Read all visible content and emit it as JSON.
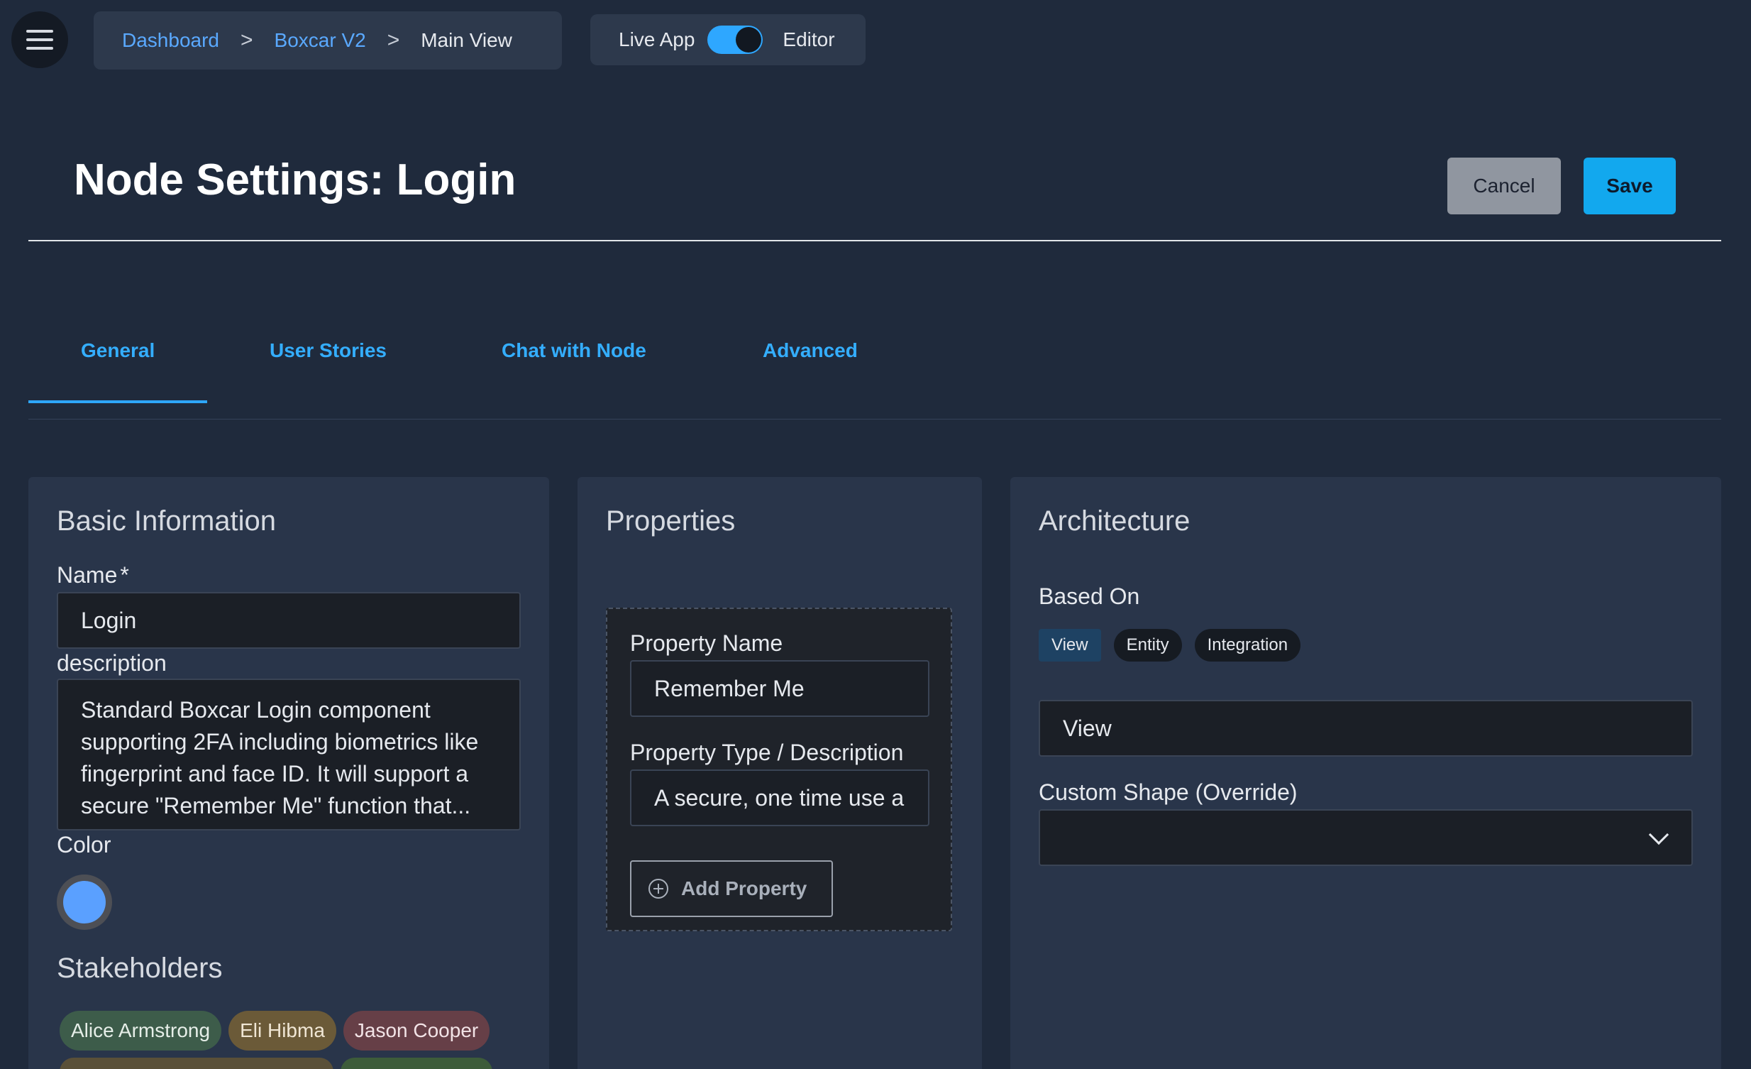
{
  "topbar": {
    "menu_icon": "hamburger-menu-icon",
    "breadcrumb": {
      "items": [
        "Dashboard",
        "Boxcar V2"
      ],
      "separator": ">",
      "current": "Main View"
    },
    "mode": {
      "left_label": "Live App",
      "right_label": "Editor",
      "state": "Editor"
    }
  },
  "header": {
    "title": "Node Settings: Login",
    "cancel_label": "Cancel",
    "save_label": "Save"
  },
  "tabs": {
    "items": [
      {
        "label": "General",
        "active": true
      },
      {
        "label": "User Stories",
        "active": false
      },
      {
        "label": "Chat with Node",
        "active": false
      },
      {
        "label": "Advanced",
        "active": false
      }
    ],
    "accent": "#2ea7ff"
  },
  "basic": {
    "heading": "Basic Information",
    "name_label": "Name",
    "required_marker": "*",
    "name_value": "Login",
    "description_label": "description",
    "description_value": "Standard Boxcar Login component supporting 2FA including biometrics like fingerprint and face ID. It will support a secure \"Remember Me\" function that...",
    "color_label": "Color",
    "color_value": "#5aa0ff",
    "stakeholders_heading": "Stakeholders",
    "stakeholders": [
      {
        "name": "Alice Armstrong",
        "color": "#3d5c4a"
      },
      {
        "name": "Eli Hibma",
        "color": "#6b5a38"
      },
      {
        "name": "Jason Cooper",
        "color": "#663f47"
      }
    ]
  },
  "properties": {
    "heading": "Properties",
    "property_name_label": "Property Name",
    "property_name_value": "Remember Me",
    "property_type_label": "Property Type / Description",
    "property_type_value": "A secure, one time use a",
    "add_label": "Add Property"
  },
  "architecture": {
    "heading": "Architecture",
    "based_on_label": "Based On",
    "options": [
      "View",
      "Entity",
      "Integration"
    ],
    "selected_option": "View",
    "based_on_value": "View",
    "custom_shape_label": "Custom Shape (Override)",
    "custom_shape_value": ""
  }
}
